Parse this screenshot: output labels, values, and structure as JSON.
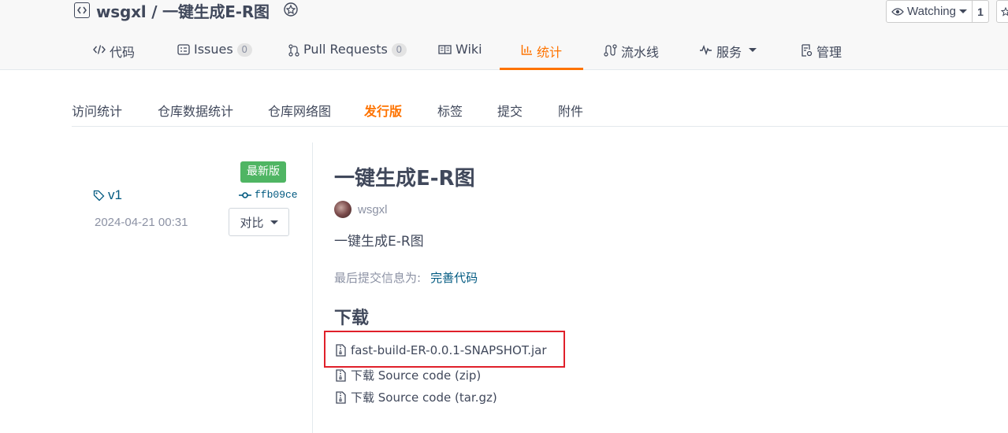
{
  "repo": {
    "title": "wsgxl / 一键生成E-R图",
    "watch_label": "Watching",
    "watch_count": "1"
  },
  "tabs": [
    {
      "label": "代码",
      "icon": "code-icon"
    },
    {
      "label": "Issues",
      "icon": "issues-icon",
      "count": "0"
    },
    {
      "label": "Pull Requests",
      "icon": "pull-request-icon",
      "count": "0"
    },
    {
      "label": "Wiki",
      "icon": "book-icon"
    },
    {
      "label": "统计",
      "icon": "bar-chart-icon",
      "active": true
    },
    {
      "label": "流水线",
      "icon": "pipeline-icon"
    },
    {
      "label": "服务",
      "icon": "pulse-icon"
    },
    {
      "label": "管理",
      "icon": "settings-doc-icon"
    }
  ],
  "subtabs": [
    {
      "label": "访问统计"
    },
    {
      "label": "仓库数据统计"
    },
    {
      "label": "仓库网络图"
    },
    {
      "label": "发行版",
      "active": true
    },
    {
      "label": "标签"
    },
    {
      "label": "提交"
    },
    {
      "label": "附件"
    }
  ],
  "release": {
    "latest_label": "最新版",
    "tag": "v1",
    "commit": "ffb09ce",
    "date": "2024-04-21 00:31",
    "compare_label": "对比",
    "title": "一键生成E-R图",
    "author": "wsgxl",
    "description": "一键生成E-R图",
    "last_commit_label": "最后提交信息为:",
    "last_commit_message": "完善代码",
    "download_heading": "下载",
    "assets": [
      {
        "label": "fast-build-ER-0.0.1-SNAPSHOT.jar"
      },
      {
        "label": "下载 Source code (zip)"
      },
      {
        "label": "下载 Source code (tar.gz)"
      }
    ]
  },
  "colors": {
    "accent": "#fe7300",
    "link": "#005980",
    "success": "#4fb563",
    "highlight": "#e0202a"
  }
}
